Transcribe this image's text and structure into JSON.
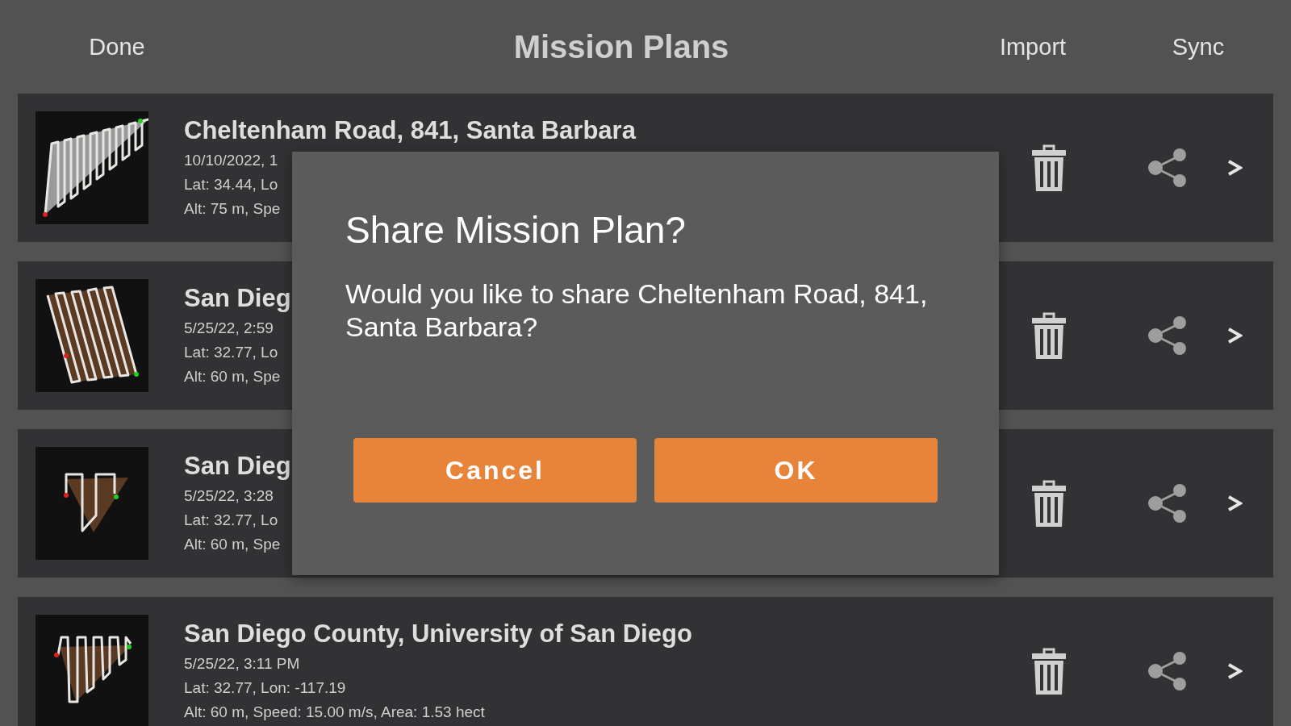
{
  "header": {
    "done": "Done",
    "title": "Mission Plans",
    "import": "Import",
    "sync": "Sync"
  },
  "missions": [
    {
      "name": "Cheltenham Road, 841, Santa Barbara",
      "date": "10/10/2022, 1",
      "location": "Lat: 34.44, Lo",
      "details": "Alt: 75 m, Spe"
    },
    {
      "name": "San Dieg",
      "date": "5/25/22, 2:59",
      "location": "Lat: 32.77, Lo",
      "details": "Alt: 60 m, Spe"
    },
    {
      "name": "San Dieg",
      "date": "5/25/22, 3:28",
      "location": "Lat: 32.77, Lo",
      "details": "Alt: 60 m, Spe"
    },
    {
      "name": "San Diego County, University of San Diego",
      "date": "5/25/22, 3:11 PM",
      "location": "Lat: 32.77, Lon: -117.19",
      "details": "Alt: 60 m, Speed: 15.00 m/s, Area: 1.53 hect"
    }
  ],
  "dialog": {
    "title": "Share Mission Plan?",
    "message": "Would you like to share Cheltenham Road, 841, Santa Barbara?",
    "buttons": [
      "Cancel",
      "OK"
    ]
  }
}
